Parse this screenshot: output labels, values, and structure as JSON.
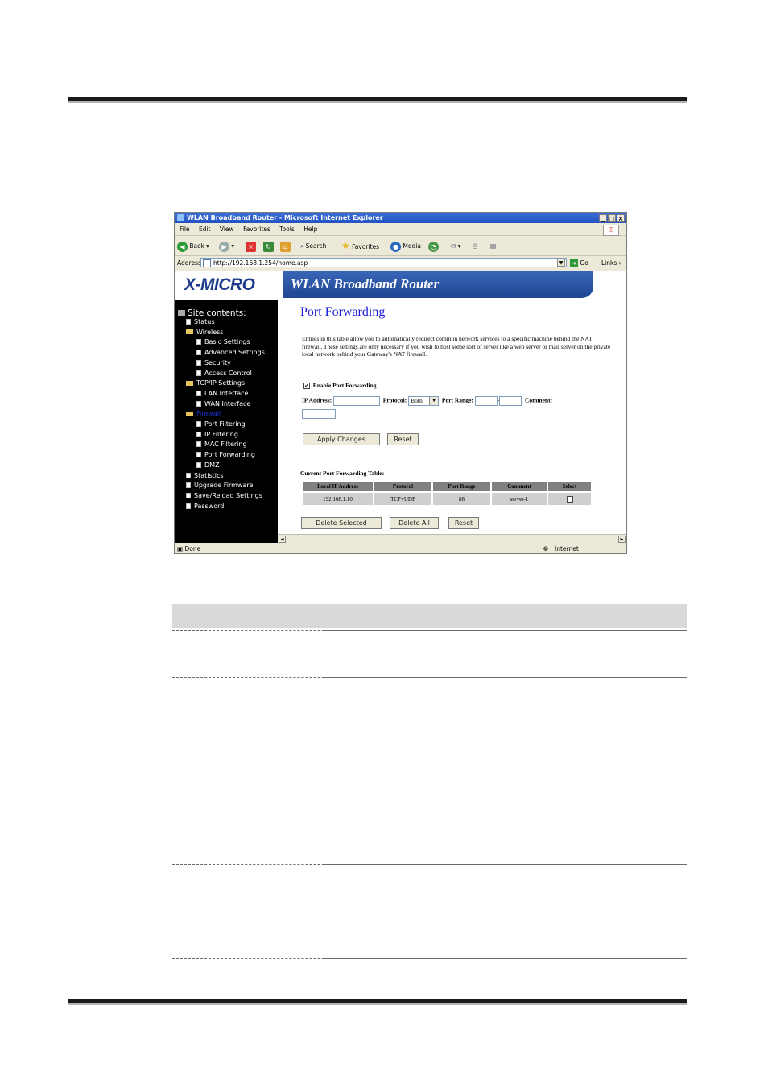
{
  "browser": {
    "title": "WLAN Broadband Router - Microsoft Internet Explorer",
    "menu": [
      "File",
      "Edit",
      "View",
      "Favorites",
      "Tools",
      "Help"
    ],
    "toolbar": {
      "back": "Back",
      "search": "Search",
      "favorites": "Favorites",
      "media": "Media"
    },
    "address_label": "Address",
    "url": "http://192.168.1.254/home.asp",
    "go": "Go",
    "links": "Links",
    "status": "Done",
    "zone": "Internet"
  },
  "page": {
    "logo": "X-MICRO",
    "banner": "WLAN Broadband Router",
    "sidebar_title": "Site contents:",
    "nav": [
      {
        "label": "Status",
        "kind": "page",
        "level": 1
      },
      {
        "label": "Wireless",
        "kind": "folder",
        "level": 1
      },
      {
        "label": "Basic Settings",
        "kind": "page",
        "level": 2
      },
      {
        "label": "Advanced Settings",
        "kind": "page",
        "level": 2
      },
      {
        "label": "Security",
        "kind": "page",
        "level": 2
      },
      {
        "label": "Access Control",
        "kind": "page",
        "level": 2
      },
      {
        "label": "TCP/IP Settings",
        "kind": "folder",
        "level": 1
      },
      {
        "label": "LAN Interface",
        "kind": "page",
        "level": 2
      },
      {
        "label": "WAN Interface",
        "kind": "page",
        "level": 2
      },
      {
        "label": "Firewall",
        "kind": "folder",
        "level": 1,
        "active": true
      },
      {
        "label": "Port Filtering",
        "kind": "page",
        "level": 2
      },
      {
        "label": "IP Filtering",
        "kind": "page",
        "level": 2
      },
      {
        "label": "MAC Filtering",
        "kind": "page",
        "level": 2
      },
      {
        "label": "Port Forwarding",
        "kind": "page",
        "level": 2
      },
      {
        "label": "DMZ",
        "kind": "page",
        "level": 2
      },
      {
        "label": "Statistics",
        "kind": "page",
        "level": 1
      },
      {
        "label": "Upgrade Firmware",
        "kind": "page",
        "level": 1
      },
      {
        "label": "Save/Reload Settings",
        "kind": "page",
        "level": 1
      },
      {
        "label": "Password",
        "kind": "page",
        "level": 1
      }
    ],
    "heading": "Port Forwarding",
    "description": "Entries in this table allow you to automatically redirect common network services to a specific machine behind the NAT firewall. These settings are only necessary if you wish to host some sort of server like a web server or mail server on the private local network behind your Gateway's NAT firewall.",
    "enable_label": "Enable Port Forwarding",
    "ip_label": "IP Address:",
    "protocol_label": "Protocol:",
    "protocol_value": "Both",
    "port_range_label": "Port Range:",
    "comment_label": "Comment:",
    "apply_button": "Apply Changes",
    "reset_button": "Reset",
    "table_title": "Current Port Forwarding Table:",
    "table_headers": [
      "Local IP Address",
      "Protocol",
      "Port Range",
      "Comment",
      "Select"
    ],
    "table_rows": [
      {
        "ip": "192.168.1.10",
        "protocol": "TCP+UDP",
        "port_range": "88",
        "comment": "server-1"
      }
    ],
    "delete_selected_button": "Delete Selected",
    "delete_all_button": "Delete All",
    "reset_button_2": "Reset"
  }
}
